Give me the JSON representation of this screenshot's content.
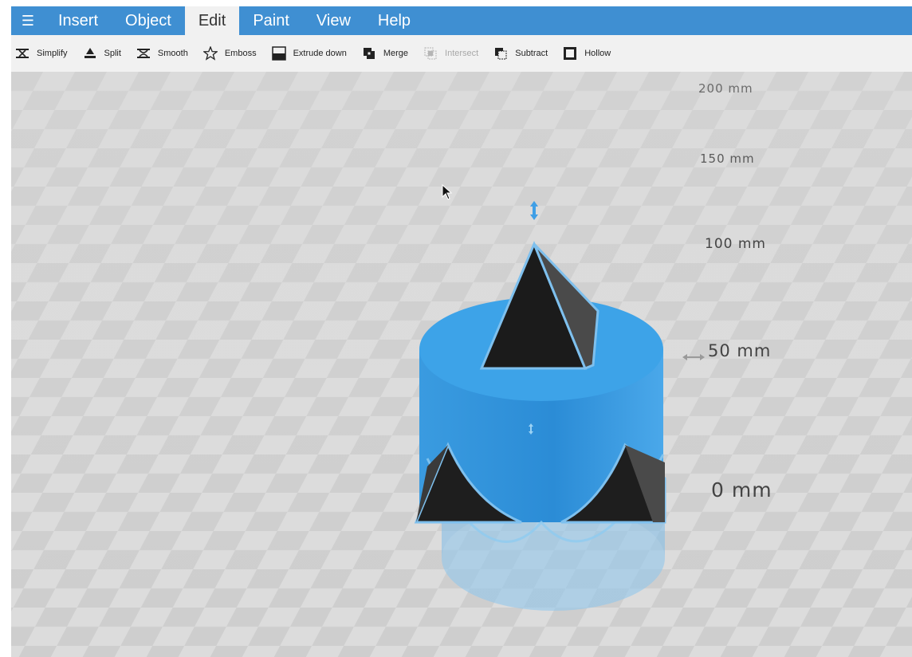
{
  "menu": {
    "hamburger_icon": "hamburger-icon",
    "items": [
      {
        "label": "Insert",
        "active": false
      },
      {
        "label": "Object",
        "active": false
      },
      {
        "label": "Edit",
        "active": true
      },
      {
        "label": "Paint",
        "active": false
      },
      {
        "label": "View",
        "active": false
      },
      {
        "label": "Help",
        "active": false
      }
    ]
  },
  "toolbar": {
    "items": [
      {
        "label": "Simplify",
        "icon": "simplify-icon",
        "enabled": true
      },
      {
        "label": "Split",
        "icon": "split-icon",
        "enabled": true
      },
      {
        "label": "Smooth",
        "icon": "smooth-icon",
        "enabled": true
      },
      {
        "label": "Emboss",
        "icon": "emboss-star-icon",
        "enabled": true
      },
      {
        "label": "Extrude down",
        "icon": "extrude-down-icon",
        "enabled": true
      },
      {
        "label": "Merge",
        "icon": "merge-icon",
        "enabled": true
      },
      {
        "label": "Intersect",
        "icon": "intersect-icon",
        "enabled": false
      },
      {
        "label": "Subtract",
        "icon": "subtract-icon",
        "enabled": true
      },
      {
        "label": "Hollow",
        "icon": "hollow-icon",
        "enabled": true
      }
    ]
  },
  "viewport": {
    "scale_labels": [
      "200 mm",
      "150 mm",
      "100 mm",
      "50 mm",
      "0 mm"
    ],
    "colors": {
      "accent": "#3f8fd2",
      "object_blue": "#3ba0e6",
      "object_dark": "#1e1e1e",
      "floor_light": "#dcdcdc",
      "floor_dark": "#cccccc"
    }
  }
}
